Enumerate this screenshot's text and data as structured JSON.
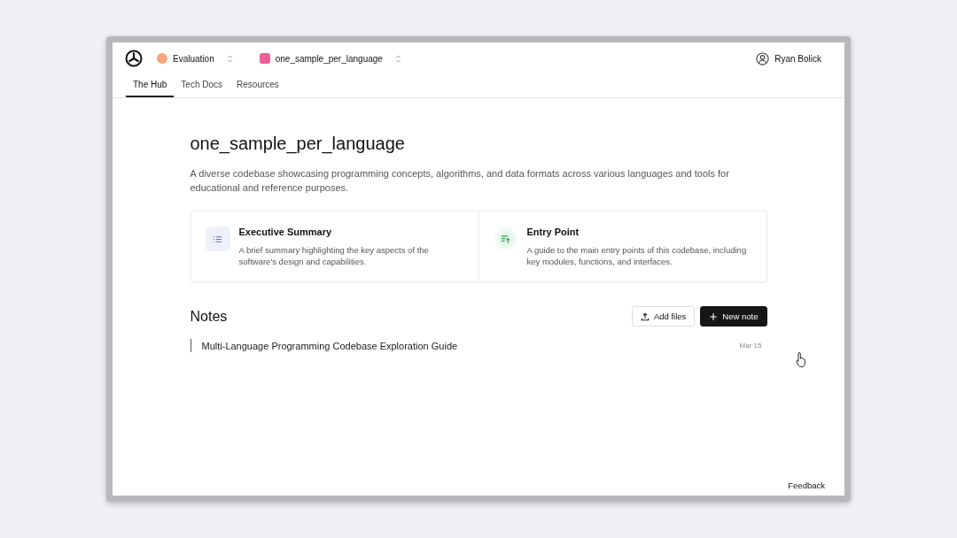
{
  "header": {
    "workspace": {
      "label": "Evaluation",
      "color": "#f4a77c"
    },
    "project": {
      "label": "one_sample_per_language",
      "color": "#ec5f96"
    },
    "user": "Ryan Bolick"
  },
  "tabs": [
    {
      "label": "The Hub",
      "selected": true
    },
    {
      "label": "Tech Docs",
      "selected": false
    },
    {
      "label": "Resources",
      "selected": false
    }
  ],
  "project": {
    "title": "one_sample_per_language",
    "description": "A diverse codebase showcasing programming concepts, algorithms, and data formats across various languages and tools for educational and reference purposes."
  },
  "cards": [
    {
      "kind": "list",
      "title": "Executive Summary",
      "description": "A brief summary highlighting the key aspects of the software's design and capabilities."
    },
    {
      "kind": "entry",
      "title": "Entry Point",
      "description": "A guide to the main entry points of this codebase, including key modules, functions, and interfaces."
    }
  ],
  "notes": {
    "title": "Notes",
    "add_button": "Add files",
    "new_button": "New note",
    "items": [
      {
        "title": "Multi-Language Programming Codebase Exploration Guide",
        "date": "Mar 15"
      }
    ]
  },
  "feedback": "Feedback"
}
